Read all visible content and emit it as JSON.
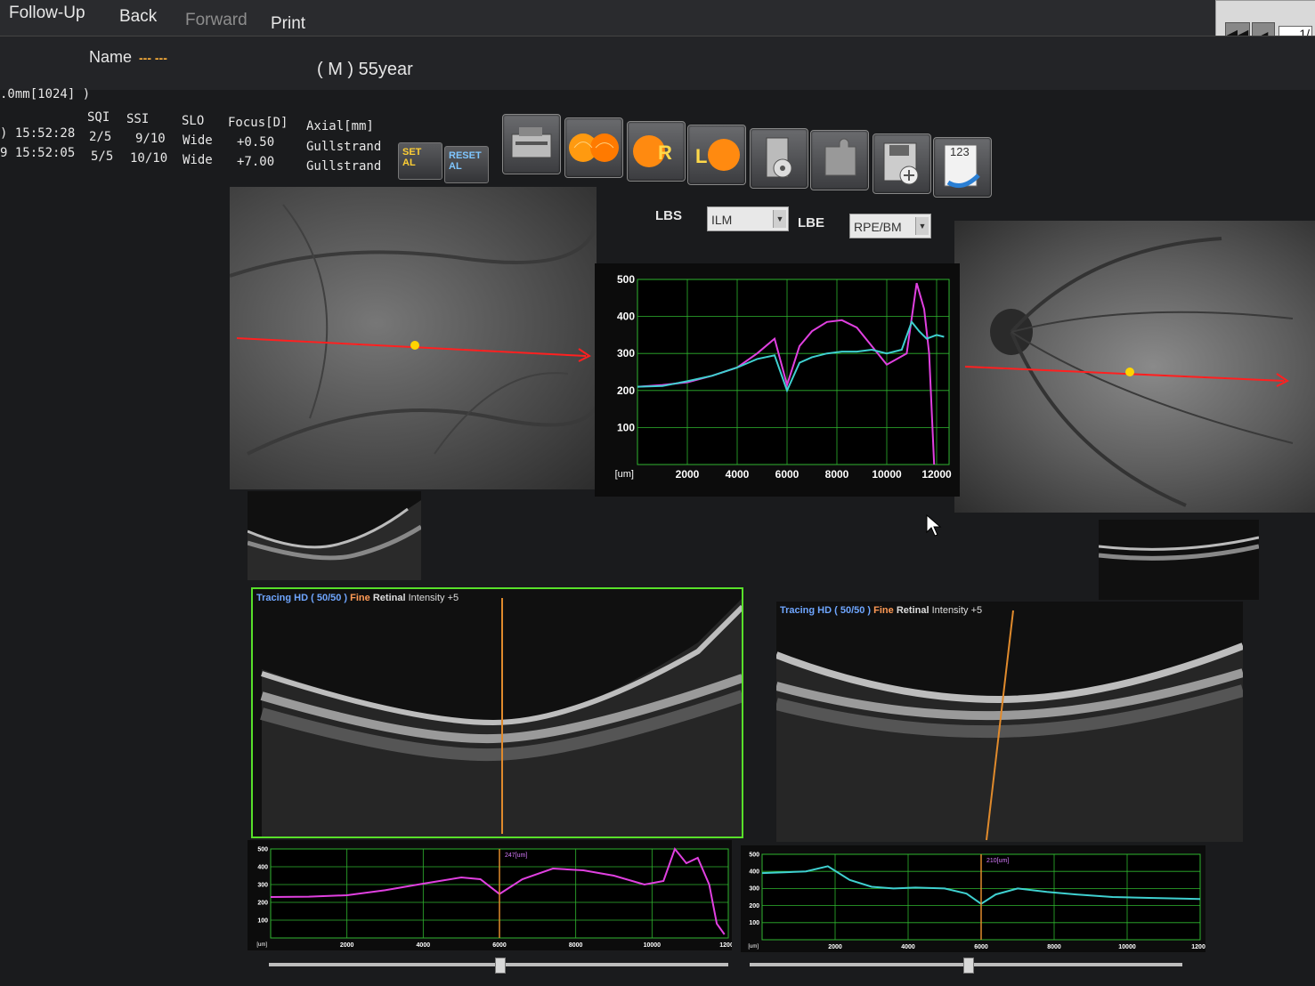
{
  "menu": {
    "follow_up": "Follow-Up",
    "back": "Back",
    "forward": "Forward",
    "print": "Print"
  },
  "nav": {
    "page": "1/"
  },
  "patient": {
    "name_label": "Name",
    "name_value": "--- ---",
    "sex_age": "( M ) 55year"
  },
  "scan_header": ".0mm[1024] )",
  "scan_table": {
    "columns": [
      "SQI",
      "SSI",
      "SLO",
      "Focus[D]",
      "Axial[mm]"
    ],
    "rows": [
      {
        "time": ") 15:52:28",
        "sqi": "2/5",
        "ssi": "9/10",
        "slo": "Wide",
        "focus": "+0.50",
        "axial": "Gullstrand"
      },
      {
        "time": "9 15:52:05",
        "sqi": "5/5",
        "ssi": "10/10",
        "slo": "Wide",
        "focus": "+7.00",
        "axial": "Gullstrand"
      }
    ]
  },
  "toolbar": {
    "set_al": "SET AL",
    "reset_al": "RESET AL",
    "r_label": "R",
    "l_label": "L",
    "counter_label": "123",
    "icons": [
      "scanner-icon",
      "both-eyes-icon",
      "right-eye-icon",
      "left-eye-icon",
      "disc-drive-icon",
      "puzzle-icon",
      "save-icon",
      "counter-icon"
    ]
  },
  "boundaries": {
    "lbs_label": "LBS",
    "lbs_value": "ILM",
    "lbe_label": "LBE",
    "lbe_value": "RPE/BM"
  },
  "oct_left": {
    "label_a": "Tracing HD ( 50/50 )",
    "label_b": "Fine",
    "label_c": "Retinal",
    "label_d": "Intensity +5"
  },
  "oct_right": {
    "label_a": "Tracing HD ( 50/50 )",
    "label_b": "Fine",
    "label_c": "Retinal",
    "label_d": "Intensity +5"
  },
  "colors": {
    "grid": "#2fb52f",
    "magenta": "#e040e0",
    "cyan": "#3fd0d0",
    "scanline": "#ff2020",
    "marker": "#ffd400",
    "cursor": "#e08a2c"
  },
  "chart_data": [
    {
      "type": "line",
      "xunit": "[um]",
      "xticks": [
        "2000",
        "4000",
        "6000",
        "8000",
        "10000",
        "12000"
      ],
      "yticks": [
        "100",
        "200",
        "300",
        "400",
        "500"
      ],
      "xlim": [
        0,
        12500
      ],
      "ylim": [
        0,
        500
      ],
      "grid": true,
      "series": [
        {
          "color": "magenta",
          "x": [
            0,
            1000,
            2000,
            3000,
            4000,
            4800,
            5500,
            6000,
            6500,
            7000,
            7600,
            8200,
            8800,
            9400,
            10000,
            10800,
            11200,
            11500,
            11700,
            11900
          ],
          "y": [
            210,
            215,
            222,
            240,
            262,
            300,
            340,
            215,
            320,
            360,
            385,
            390,
            370,
            320,
            270,
            300,
            490,
            420,
            300,
            0
          ]
        },
        {
          "color": "cyan",
          "x": [
            0,
            1000,
            2000,
            3000,
            4000,
            4800,
            5500,
            6000,
            6500,
            7000,
            7600,
            8200,
            8800,
            9400,
            10000,
            10600,
            11000,
            11300,
            11600,
            12000,
            12300
          ],
          "y": [
            210,
            212,
            225,
            240,
            262,
            285,
            295,
            200,
            275,
            290,
            300,
            305,
            305,
            310,
            300,
            310,
            385,
            360,
            340,
            350,
            345
          ]
        }
      ]
    },
    {
      "type": "line",
      "xunit": "[um]",
      "xticks": [
        "2000",
        "4000",
        "6000",
        "8000",
        "10000",
        "12000"
      ],
      "yticks": [
        "100",
        "200",
        "300",
        "400",
        "500"
      ],
      "xlim": [
        0,
        12000
      ],
      "ylim": [
        0,
        500
      ],
      "grid": true,
      "cursor_x": 6000,
      "cursor_label": "247[um]",
      "series": [
        {
          "color": "magenta",
          "x": [
            0,
            1000,
            2000,
            3000,
            4000,
            5000,
            5500,
            6000,
            6600,
            7400,
            8200,
            9000,
            9800,
            10300,
            10600,
            10900,
            11200,
            11500,
            11700,
            11900
          ],
          "y": [
            230,
            232,
            240,
            268,
            305,
            340,
            330,
            247,
            330,
            390,
            380,
            350,
            300,
            320,
            500,
            420,
            450,
            300,
            80,
            20
          ]
        }
      ]
    },
    {
      "type": "line",
      "xunit": "[um]",
      "xticks": [
        "2000",
        "4000",
        "6000",
        "8000",
        "10000",
        "12000"
      ],
      "yticks": [
        "100",
        "200",
        "300",
        "400",
        "500"
      ],
      "xlim": [
        0,
        12000
      ],
      "ylim": [
        0,
        500
      ],
      "grid": true,
      "cursor_x": 6000,
      "cursor_label": "210[um]",
      "series": [
        {
          "color": "cyan",
          "x": [
            0,
            600,
            1200,
            1800,
            2400,
            3000,
            3600,
            4200,
            5000,
            5600,
            6000,
            6400,
            7000,
            7800,
            8600,
            9600,
            10600,
            11600,
            12000
          ],
          "y": [
            390,
            395,
            400,
            430,
            350,
            310,
            300,
            305,
            300,
            270,
            210,
            265,
            300,
            280,
            265,
            250,
            245,
            240,
            238
          ]
        }
      ]
    }
  ]
}
